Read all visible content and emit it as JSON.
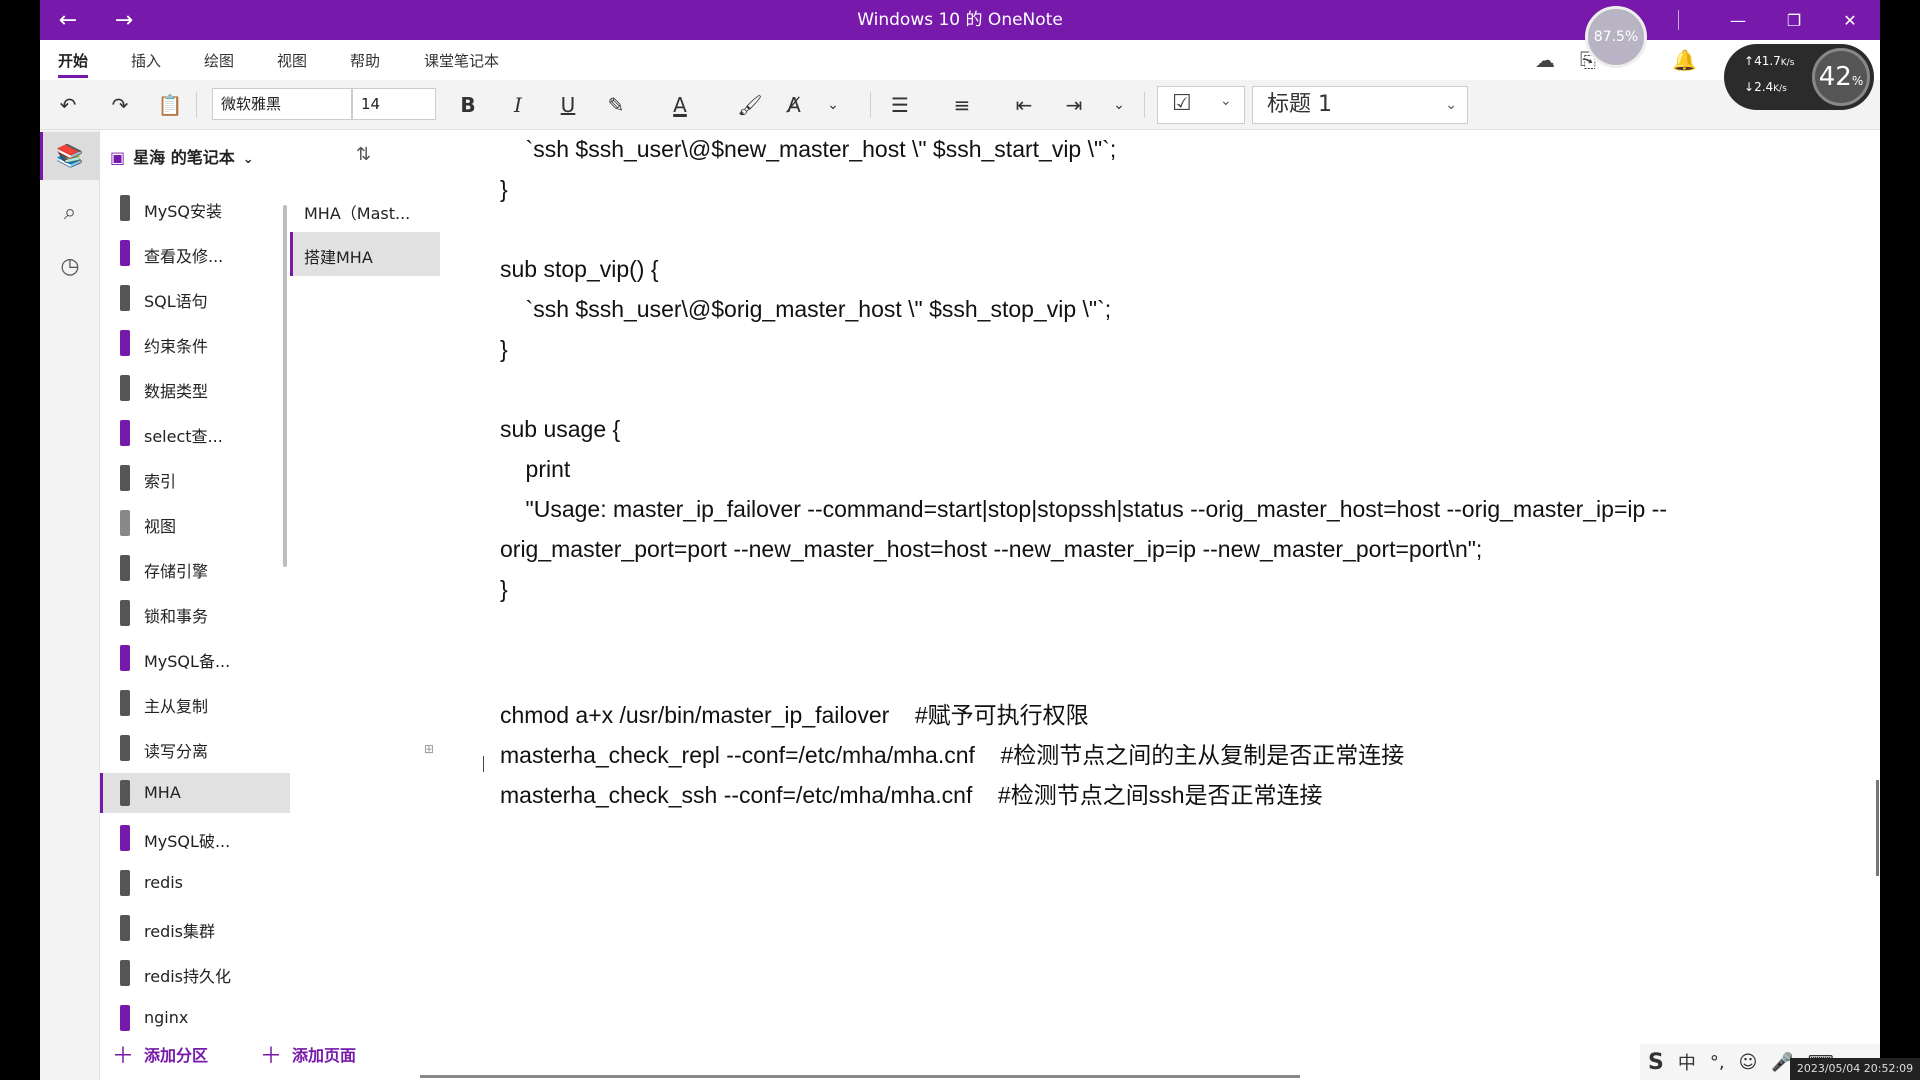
{
  "window": {
    "title": "Windows 10 的 OneNote",
    "avatar_text": "87.5%"
  },
  "menu": {
    "tabs": [
      "开始",
      "插入",
      "绘图",
      "视图",
      "帮助",
      "课堂笔记本"
    ]
  },
  "speed_widget": {
    "up": "41.7",
    "up_unit": "K/s",
    "down": "2.4",
    "down_unit": "K/s",
    "percent": "42"
  },
  "ribbon": {
    "font_name": "微软雅黑",
    "font_size": "14",
    "style": "标题 1",
    "bold": "B",
    "italic": "I",
    "underline": "U"
  },
  "notebook": {
    "name": "星海 的笔记本"
  },
  "sections": [
    {
      "label": "MySQ安装",
      "color": "#555555"
    },
    {
      "label": "查看及修...",
      "color": "#7719aa"
    },
    {
      "label": "SQL语句",
      "color": "#555555"
    },
    {
      "label": "约束条件",
      "color": "#7719aa"
    },
    {
      "label": "数据类型",
      "color": "#555555"
    },
    {
      "label": "select查...",
      "color": "#7719aa"
    },
    {
      "label": "索引",
      "color": "#555555"
    },
    {
      "label": "视图",
      "color": "#888888"
    },
    {
      "label": "存储引擎",
      "color": "#555555"
    },
    {
      "label": "锁和事务",
      "color": "#555555"
    },
    {
      "label": "MySQL备...",
      "color": "#7719aa"
    },
    {
      "label": "主从复制",
      "color": "#555555"
    },
    {
      "label": "读写分离",
      "color": "#555555"
    },
    {
      "label": "MHA",
      "color": "#555555",
      "selected": true
    },
    {
      "label": "MySQL破...",
      "color": "#7719aa"
    },
    {
      "label": "redis",
      "color": "#555555"
    },
    {
      "label": "redis集群",
      "color": "#555555"
    },
    {
      "label": "redis持久化",
      "color": "#555555"
    },
    {
      "label": "nginx",
      "color": "#7719aa"
    }
  ],
  "pages": [
    {
      "label": "MHA（Mast..."
    },
    {
      "label": "搭建MHA",
      "selected": true
    }
  ],
  "bottom": {
    "add_section": "添加分区",
    "add_page": "添加页面"
  },
  "content": {
    "lines": [
      "    `ssh $ssh_user\\@$new_master_host \\\" $ssh_start_vip \\\"`;",
      "}",
      "",
      "sub stop_vip() {",
      "    `ssh $ssh_user\\@$orig_master_host \\\" $ssh_stop_vip \\\"`;",
      "}",
      "",
      "sub usage {",
      "    print",
      "    \"Usage: master_ip_failover --command=start|stop|stopssh|status --orig_master_host=host --orig_master_ip=ip --",
      "orig_master_port=port --new_master_host=host --new_master_ip=ip --new_master_port=port\\n\";",
      "}",
      "",
      "",
      "chmod a+x /usr/bin/master_ip_failover    #赋予可执行权限",
      "masterha_check_repl --conf=/etc/mha/mha.cnf    #检测节点之间的主从复制是否正常连接",
      "masterha_check_ssh --conf=/etc/mha/mha.cnf    #检测节点之间ssh是否正常连接"
    ]
  },
  "taskbar": {
    "ime_lang": "中",
    "datetime": "2023/05/04 20:52:09"
  }
}
